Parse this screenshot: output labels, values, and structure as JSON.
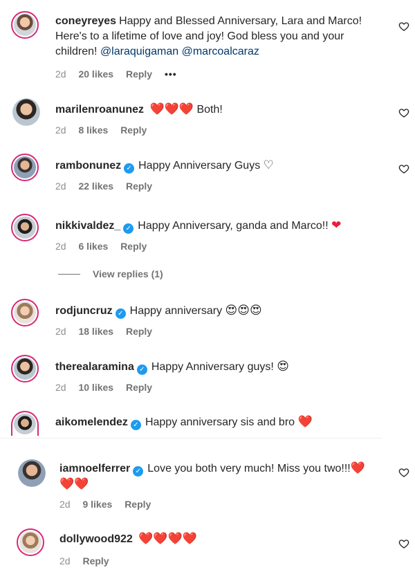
{
  "comments": [
    {
      "username": "coneyreyes",
      "text": "Happy and Blessed Anniversary, Lara and Marco! Here's to a lifetime of love and joy! God bless you and your children!",
      "mention1": "@laraquigaman",
      "mention2": "@marcoalcaraz",
      "time": "2d",
      "likes": "20 likes",
      "reply": "Reply",
      "more": "•••"
    },
    {
      "username": "marilenroanunez",
      "emojis": "❤️❤️❤️",
      "text": "Both!",
      "time": "2d",
      "likes": "8 likes",
      "reply": "Reply"
    },
    {
      "username": "rambonunez",
      "text": "Happy Anniversary Guys",
      "emoji_after": "♡",
      "time": "2d",
      "likes": "22 likes",
      "reply": "Reply"
    },
    {
      "username": "nikkivaldez_",
      "text": "Happy Anniversary, ganda and Marco!!",
      "emoji_after": "❤",
      "time": "2d",
      "likes": "6 likes",
      "reply": "Reply",
      "view_replies": "View replies (1)"
    },
    {
      "username": "rodjuncruz",
      "text": "Happy anniversary",
      "emoji_after": "😍😍😍",
      "time": "2d",
      "likes": "18 likes",
      "reply": "Reply"
    },
    {
      "username": "therealaramina",
      "text": "Happy Anniversary guys!",
      "emoji_after": "😍",
      "time": "2d",
      "likes": "10 likes",
      "reply": "Reply"
    },
    {
      "username": "aikomelendez",
      "text": "Happy anniversary sis and bro",
      "emoji_after": "❤️"
    },
    {
      "username": "iamnoelferrer",
      "text": "Love you both very much! Miss you two!!!",
      "emoji_after": "❤️❤️❤️",
      "time": "2d",
      "likes": "9 likes",
      "reply": "Reply"
    },
    {
      "username": "dollywood922",
      "emojis": "❤️❤️❤️❤️",
      "time": "2d",
      "reply": "Reply"
    }
  ],
  "colors": {
    "text": "#262626",
    "secondary": "#8e8e8e",
    "mention": "#00376b",
    "verified": "#1d9bf0",
    "heart": "#ed1c3a",
    "story_ring": "#d62976"
  }
}
